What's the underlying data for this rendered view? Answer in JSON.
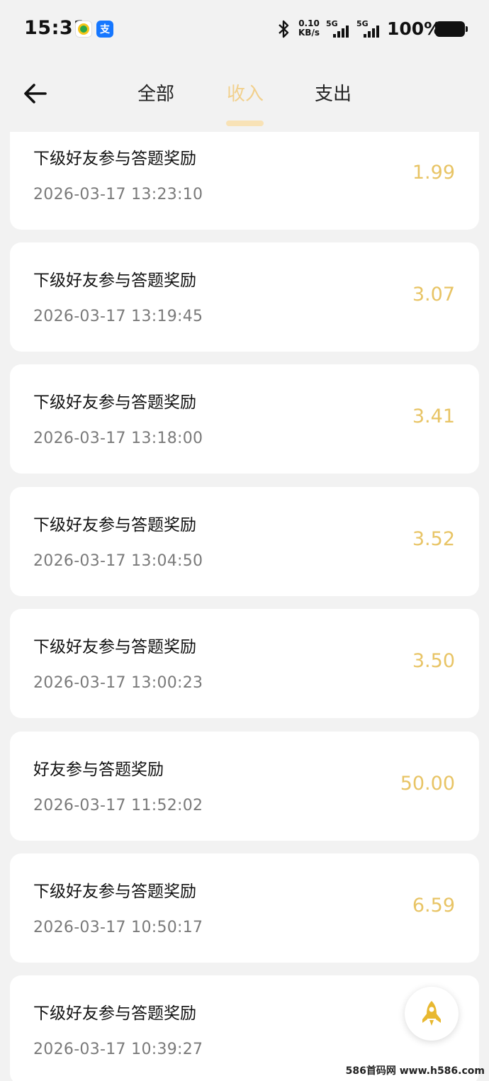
{
  "status_bar": {
    "time": "15:31",
    "app_icon_2_label": "支",
    "net_speed_value": "0.10",
    "net_speed_unit": "KB/s",
    "sim1_label": "5G",
    "sim2_label": "5G",
    "battery": "100%"
  },
  "nav": {
    "tabs": [
      {
        "label": "全部"
      },
      {
        "label": "收入"
      },
      {
        "label": "支出"
      }
    ],
    "active_tab": "收入"
  },
  "records": [
    {
      "title": "下级好友参与答题奖励",
      "time": "2026-03-17 13:23:10",
      "amount": "1.99"
    },
    {
      "title": "下级好友参与答题奖励",
      "time": "2026-03-17 13:19:45",
      "amount": "3.07"
    },
    {
      "title": "下级好友参与答题奖励",
      "time": "2026-03-17 13:18:00",
      "amount": "3.41"
    },
    {
      "title": "下级好友参与答题奖励",
      "time": "2026-03-17 13:04:50",
      "amount": "3.52"
    },
    {
      "title": "下级好友参与答题奖励",
      "time": "2026-03-17 13:00:23",
      "amount": "3.50"
    },
    {
      "title": "好友参与答题奖励",
      "time": "2026-03-17 11:52:02",
      "amount": "50.00"
    },
    {
      "title": "下级好友参与答题奖励",
      "time": "2026-03-17 10:50:17",
      "amount": "6.59"
    },
    {
      "title": "下级好友参与答题奖励",
      "time": "2026-03-17 10:39:27",
      "amount": ""
    }
  ],
  "watermark": "586首码网 www.h586.com",
  "colors": {
    "accent_amount": "#e8c465",
    "active_tab": "#f2d08c",
    "background": "#f2f2f2"
  },
  "icons": [
    "back-arrow-icon",
    "rocket-icon",
    "bluetooth-icon",
    "signal-icon",
    "battery-icon"
  ]
}
